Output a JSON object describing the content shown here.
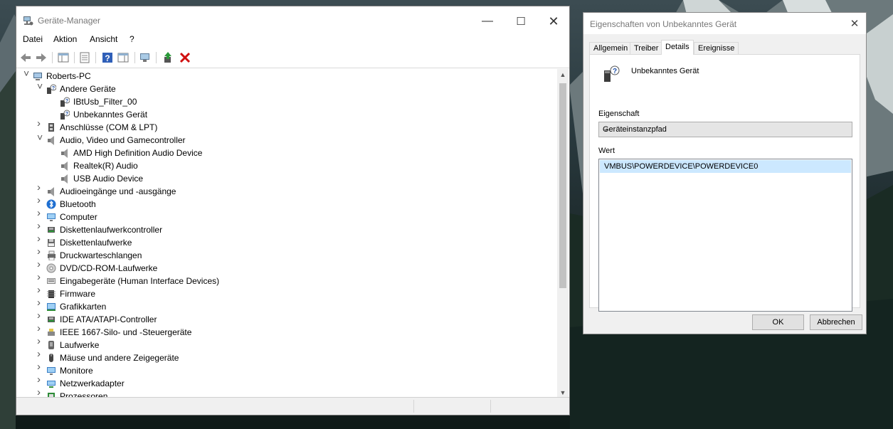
{
  "device_manager": {
    "title": "Geräte-Manager",
    "menu": [
      "Datei",
      "Aktion",
      "Ansicht",
      "?"
    ],
    "tree": [
      {
        "label": "Roberts-PC",
        "level": 0,
        "state": "expanded",
        "icon": "computer-icon"
      },
      {
        "label": "Andere Geräte",
        "level": 1,
        "state": "expanded",
        "icon": "unknown-device-icon"
      },
      {
        "label": "IBtUsb_Filter_00",
        "level": 2,
        "state": "leaf",
        "icon": "unknown-device-icon"
      },
      {
        "label": "Unbekanntes Gerät",
        "level": 2,
        "state": "leaf",
        "icon": "unknown-device-icon"
      },
      {
        "label": "Anschlüsse (COM & LPT)",
        "level": 1,
        "state": "collapsed",
        "icon": "port-icon"
      },
      {
        "label": "Audio, Video und Gamecontroller",
        "level": 1,
        "state": "expanded",
        "icon": "speaker-icon"
      },
      {
        "label": "AMD High Definition Audio Device",
        "level": 2,
        "state": "leaf",
        "icon": "speaker-icon"
      },
      {
        "label": "Realtek(R) Audio",
        "level": 2,
        "state": "leaf",
        "icon": "speaker-icon"
      },
      {
        "label": "USB Audio Device",
        "level": 2,
        "state": "leaf",
        "icon": "speaker-icon"
      },
      {
        "label": "Audioeingänge und -ausgänge",
        "level": 1,
        "state": "collapsed",
        "icon": "speaker-icon"
      },
      {
        "label": "Bluetooth",
        "level": 1,
        "state": "collapsed",
        "icon": "bluetooth-icon"
      },
      {
        "label": "Computer",
        "level": 1,
        "state": "collapsed",
        "icon": "monitor-icon"
      },
      {
        "label": "Diskettenlaufwerkcontroller",
        "level": 1,
        "state": "collapsed",
        "icon": "controller-icon"
      },
      {
        "label": "Diskettenlaufwerke",
        "level": 1,
        "state": "collapsed",
        "icon": "floppy-icon"
      },
      {
        "label": "Druckwarteschlangen",
        "level": 1,
        "state": "collapsed",
        "icon": "printer-icon"
      },
      {
        "label": "DVD/CD-ROM-Laufwerke",
        "level": 1,
        "state": "collapsed",
        "icon": "dvd-icon"
      },
      {
        "label": "Eingabegeräte (Human Interface Devices)",
        "level": 1,
        "state": "collapsed",
        "icon": "hid-icon"
      },
      {
        "label": "Firmware",
        "level": 1,
        "state": "collapsed",
        "icon": "chip-icon"
      },
      {
        "label": "Grafikkarten",
        "level": 1,
        "state": "collapsed",
        "icon": "graphics-card-icon"
      },
      {
        "label": "IDE ATA/ATAPI-Controller",
        "level": 1,
        "state": "collapsed",
        "icon": "controller-icon"
      },
      {
        "label": "IEEE 1667-Silo- und -Steuergeräte",
        "level": 1,
        "state": "collapsed",
        "icon": "usb-drive-icon"
      },
      {
        "label": "Laufwerke",
        "level": 1,
        "state": "collapsed",
        "icon": "disk-drive-icon"
      },
      {
        "label": "Mäuse und andere Zeigegeräte",
        "level": 1,
        "state": "collapsed",
        "icon": "mouse-icon"
      },
      {
        "label": "Monitore",
        "level": 1,
        "state": "collapsed",
        "icon": "monitor-icon"
      },
      {
        "label": "Netzwerkadapter",
        "level": 1,
        "state": "collapsed",
        "icon": "network-icon"
      },
      {
        "label": "Prozessoren",
        "level": 1,
        "state": "collapsed",
        "icon": "cpu-icon"
      }
    ]
  },
  "properties_dialog": {
    "title": "Eigenschaften von Unbekanntes Gerät",
    "tabs": [
      "Allgemein",
      "Treiber",
      "Details",
      "Ereignisse"
    ],
    "active_tab": "Details",
    "device_name": "Unbekanntes Gerät",
    "property_label": "Eigenschaft",
    "property_value": "Geräteinstanzpfad",
    "value_label": "Wert",
    "value": "VMBUS\\POWERDEVICE\\POWERDEVICE0",
    "ok_label": "OK",
    "cancel_label": "Abbrechen"
  }
}
